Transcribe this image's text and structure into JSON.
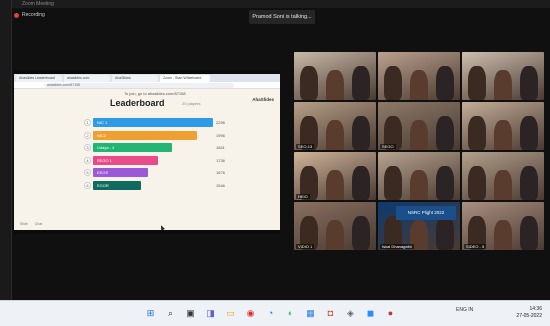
{
  "window": {
    "title": "Zoom Meeting"
  },
  "recording": {
    "label": "Recording"
  },
  "talking_indicator": "Pramod Soni is talking...",
  "browser": {
    "tabs": [
      "Ahaslides Leaderboard",
      "ahaslides.com",
      "AhaSlides",
      "Zoom - Start Whiteboard"
    ],
    "address": "ahaslides.com/87158"
  },
  "slide": {
    "join_text": "To join, go to ahaslides.com/87158",
    "brand": "AhaSlides",
    "title": "Leaderboard",
    "subtitle": "20 players",
    "footer": [
      "Slide",
      "Chat"
    ],
    "entries": [
      {
        "rank": "1",
        "name": "NIC 1",
        "score": "2296",
        "fraction": 1.0,
        "color": "#2e9be6"
      },
      {
        "rank": "2",
        "name": "NIC2",
        "score": "1996",
        "fraction": 0.87,
        "color": "#f0a030"
      },
      {
        "rank": "3",
        "name": "Udaya - 4",
        "score": "1841",
        "fraction": 0.66,
        "color": "#22b573"
      },
      {
        "rank": "4",
        "name": "SEGO 1",
        "score": "1736",
        "fraction": 0.54,
        "color": "#e84a8a"
      },
      {
        "rank": "5",
        "name": "EEGS",
        "score": "1676",
        "fraction": 0.46,
        "color": "#9b59d6"
      },
      {
        "rank": "6",
        "name": "EGOR",
        "score": "1546",
        "fraction": 0.4,
        "color": "#0f6b60"
      }
    ]
  },
  "participants": [
    {
      "name": "",
      "bg": "#c9b9a8"
    },
    {
      "name": "",
      "bg": "#bba18e"
    },
    {
      "name": "",
      "bg": "#cdbfae"
    },
    {
      "name": "SEO-13",
      "bg": "#b79f88"
    },
    {
      "name": "SEGO",
      "bg": "#8d7a6a"
    },
    {
      "name": "",
      "bg": "#c4ad98"
    },
    {
      "name": "HEIO",
      "bg": "#d0b49a"
    },
    {
      "name": "",
      "bg": "#b7a38f"
    },
    {
      "name": "",
      "bg": "#b3a08c"
    },
    {
      "name": "VIDIO 1",
      "bg": "#8a7060"
    },
    {
      "name": "Iskal Dhanagathi",
      "bg": "#0d3a6e"
    },
    {
      "name": "SIDEO - 5",
      "bg": "#a98f80"
    }
  ],
  "tile_inset": "NSRC Plight 2022",
  "taskbar": {
    "icons": [
      {
        "glyph": "⊞",
        "color": "#1e6fd9",
        "name": "windows-start-icon"
      },
      {
        "glyph": "⌕",
        "color": "#333",
        "name": "search-icon"
      },
      {
        "glyph": "▣",
        "color": "#333",
        "name": "task-view-icon"
      },
      {
        "glyph": "◨",
        "color": "#5b5fc7",
        "name": "widgets-icon"
      },
      {
        "glyph": "▭",
        "color": "#e8a317",
        "name": "file-explorer-icon"
      },
      {
        "glyph": "◉",
        "color": "#d93025",
        "name": "chrome-icon"
      },
      {
        "glyph": "◔",
        "color": "#0b84d8",
        "name": "edge-icon"
      },
      {
        "glyph": "◐",
        "color": "#1ed760",
        "name": "spotify-icon"
      },
      {
        "glyph": "▦",
        "color": "#2b7de9",
        "name": "store-icon"
      },
      {
        "glyph": "◘",
        "color": "#d24726",
        "name": "office-icon"
      },
      {
        "glyph": "◈",
        "color": "#666",
        "name": "app-icon"
      },
      {
        "glyph": "◼",
        "color": "#2d8cff",
        "name": "zoom-icon"
      },
      {
        "glyph": "●",
        "color": "#c0392b",
        "name": "recorder-icon"
      }
    ],
    "lang": "ENG\nIN",
    "time": "14:36",
    "date": "27-05-2022"
  }
}
